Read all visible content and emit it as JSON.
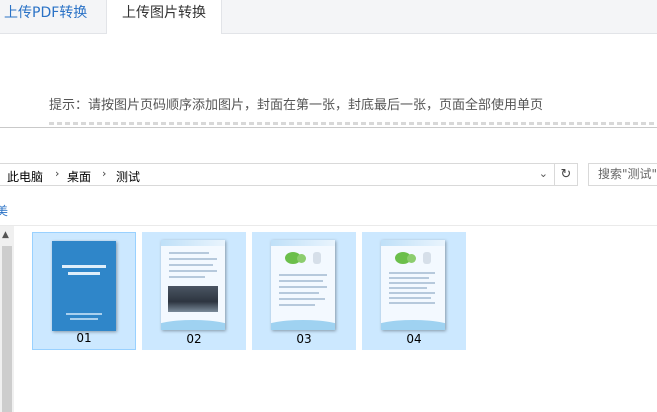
{
  "tabs": [
    {
      "label": "上传PDF转换"
    },
    {
      "label": "上传图片转换"
    }
  ],
  "hint": "提示：请按图片页码顺序添加图片，封面在第一张，封底最后一张，页面全部使用单页",
  "dialog": {
    "breadcrumb": [
      "此电脑",
      "桌面",
      "测试"
    ],
    "search_placeholder": "搜索\"测试\"",
    "command_fragment": "美",
    "files": [
      {
        "name": "01",
        "selected": true
      },
      {
        "name": "02",
        "selected": false
      },
      {
        "name": "03",
        "selected": false
      },
      {
        "name": "04",
        "selected": false
      }
    ]
  },
  "colors": {
    "link": "#2a72c6",
    "selection": "#cce8ff",
    "selection_border": "#99d1ff"
  }
}
